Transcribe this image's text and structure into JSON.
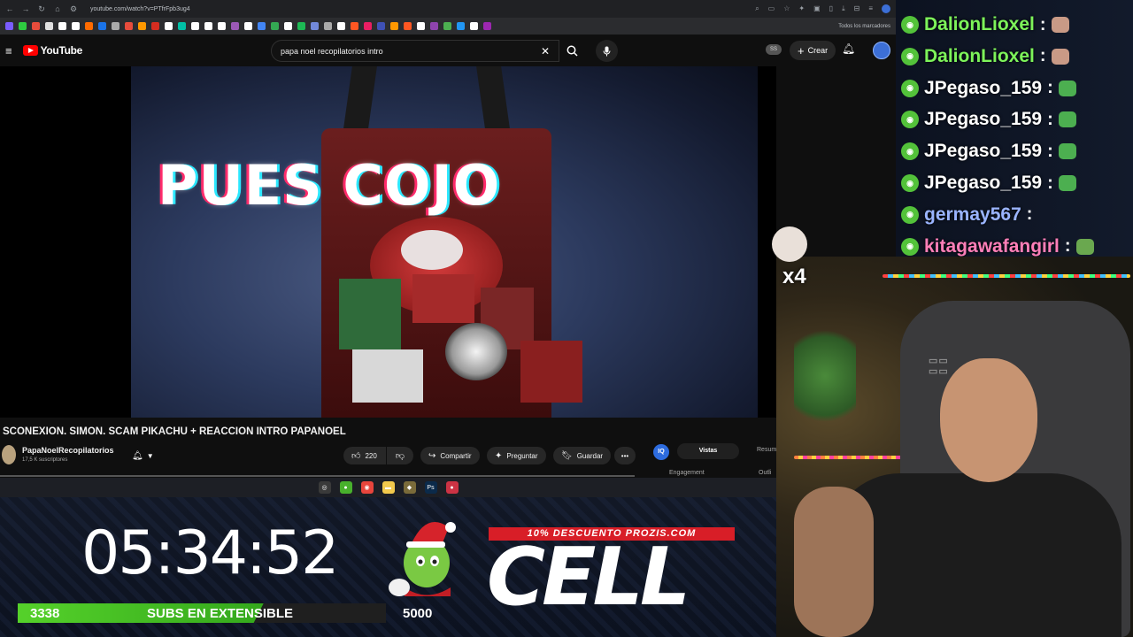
{
  "browser": {
    "url": "youtube.com/watch?v=PTfrFpb3ug4",
    "bookmarks_all_label": "Todos los marcadores",
    "bookmark_colors": [
      "#7a5cff",
      "#2ecc40",
      "#e74c3c",
      "#e0e0e0",
      "#ffffff",
      "#ffffff",
      "#ff6b00",
      "#1a73e8",
      "#aaaaaa",
      "#e74c3c",
      "#ff9800",
      "#d62d20",
      "#ffffff",
      "#00bfa5",
      "#ffffff",
      "#ffffff",
      "#ffffff",
      "#9b59b6",
      "#ffffff",
      "#4285f4",
      "#34a853",
      "#ffffff",
      "#1db954",
      "#7289da",
      "#aaaaaa",
      "#ffffff",
      "#ff5722",
      "#e91e63",
      "#3f51b5",
      "#ff9800",
      "#ff5722",
      "#ffffff",
      "#8e44ad",
      "#4caf50",
      "#2196f3",
      "#ffffff",
      "#9c27b0"
    ]
  },
  "youtube": {
    "logo_text": "YouTube",
    "search_value": "papa noel recopilatorios intro",
    "ss_badge": "SS",
    "create_label": "Crear",
    "video_caption": "PUES COJO",
    "video_title": "SCONEXION. SIMON. SCAM PIKACHU + REACCION INTRO PAPANOEL",
    "channel_name": "PapaNoelRecopilatorios",
    "channel_subs": "17,5 K suscriptores",
    "likes": "220",
    "share_label": "Compartir",
    "ask_label": "Preguntar",
    "save_label": "Guardar",
    "panel_badge": "IQ",
    "panel_tab_active": "Vistas",
    "panel_tab_other": "Resum",
    "panel_engagement": "Engagement",
    "panel_outline": "Outli"
  },
  "stream_overlay": {
    "timer": "05:34:52",
    "subs_current": "3338",
    "subs_label": "SUBS EN EXTENSIBLE",
    "subs_goal": "5000",
    "subs_progress_fraction": 0.6676,
    "promo_text": "10% DESCUENTO PROZIS.COM",
    "promo_code": "CELL",
    "gift_multiplier": "x4"
  },
  "chat": {
    "messages": [
      {
        "user": "DalionLioxel",
        "color": "#7df35a",
        "emote_color": "#c99a86"
      },
      {
        "user": "DalionLioxel",
        "color": "#7df35a",
        "emote_color": "#c99a86"
      },
      {
        "user": "JPegaso_159",
        "color": "#ffffff",
        "emote_color": "#4caf50"
      },
      {
        "user": "JPegaso_159",
        "color": "#ffffff",
        "emote_color": "#4caf50"
      },
      {
        "user": "JPegaso_159",
        "color": "#ffffff",
        "emote_color": "#4caf50"
      },
      {
        "user": "JPegaso_159",
        "color": "#ffffff",
        "emote_color": "#4caf50"
      },
      {
        "user": "germay567",
        "color": "#9ab4ff",
        "emote_color": ""
      },
      {
        "user": "kitagawafangirl",
        "color": "#ff7fb8",
        "emote_color": "#6aa84f"
      }
    ]
  },
  "taskbar": {
    "icons": [
      {
        "name": "obs-icon",
        "color": "#3a3a3a",
        "glyph": "◎"
      },
      {
        "name": "xbox-icon",
        "color": "#48b02c",
        "glyph": "●"
      },
      {
        "name": "chrome-icon",
        "color": "#e8453c",
        "glyph": "◉"
      },
      {
        "name": "folder-icon",
        "color": "#f2c94c",
        "glyph": "▬"
      },
      {
        "name": "minecraft-icon",
        "color": "#7a6b3a",
        "glyph": "◆"
      },
      {
        "name": "photoshop-icon",
        "color": "#0b2a4a",
        "glyph": "Ps"
      },
      {
        "name": "discord-icon",
        "color": "#cc3344",
        "glyph": "●"
      }
    ]
  }
}
